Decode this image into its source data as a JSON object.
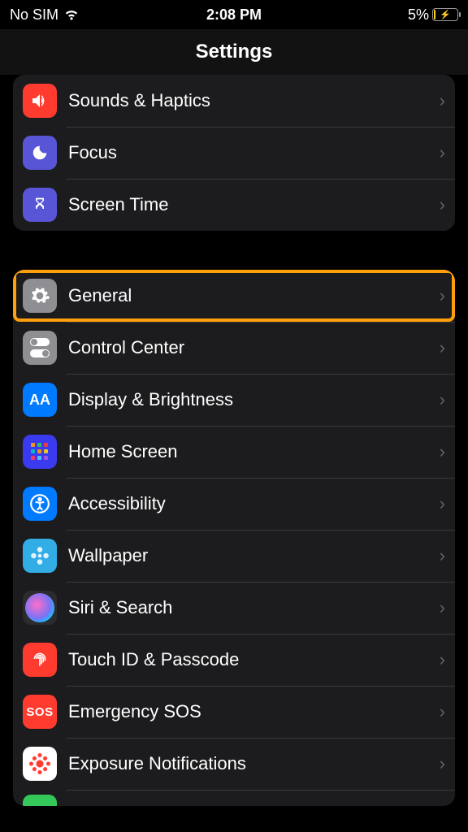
{
  "status": {
    "carrier": "No SIM",
    "time": "2:08 PM",
    "battery_percent": "5%"
  },
  "header": {
    "title": "Settings"
  },
  "groups": [
    {
      "rows": [
        {
          "label": "Sounds & Haptics"
        },
        {
          "label": "Focus"
        },
        {
          "label": "Screen Time"
        }
      ]
    },
    {
      "rows": [
        {
          "label": "General"
        },
        {
          "label": "Control Center"
        },
        {
          "label": "Display & Brightness"
        },
        {
          "label": "Home Screen"
        },
        {
          "label": "Accessibility"
        },
        {
          "label": "Wallpaper"
        },
        {
          "label": "Siri & Search"
        },
        {
          "label": "Touch ID & Passcode"
        },
        {
          "label": "Emergency SOS"
        },
        {
          "label": "Exposure Notifications"
        }
      ]
    }
  ],
  "sos_text": "SOS",
  "aa_text": "AA"
}
